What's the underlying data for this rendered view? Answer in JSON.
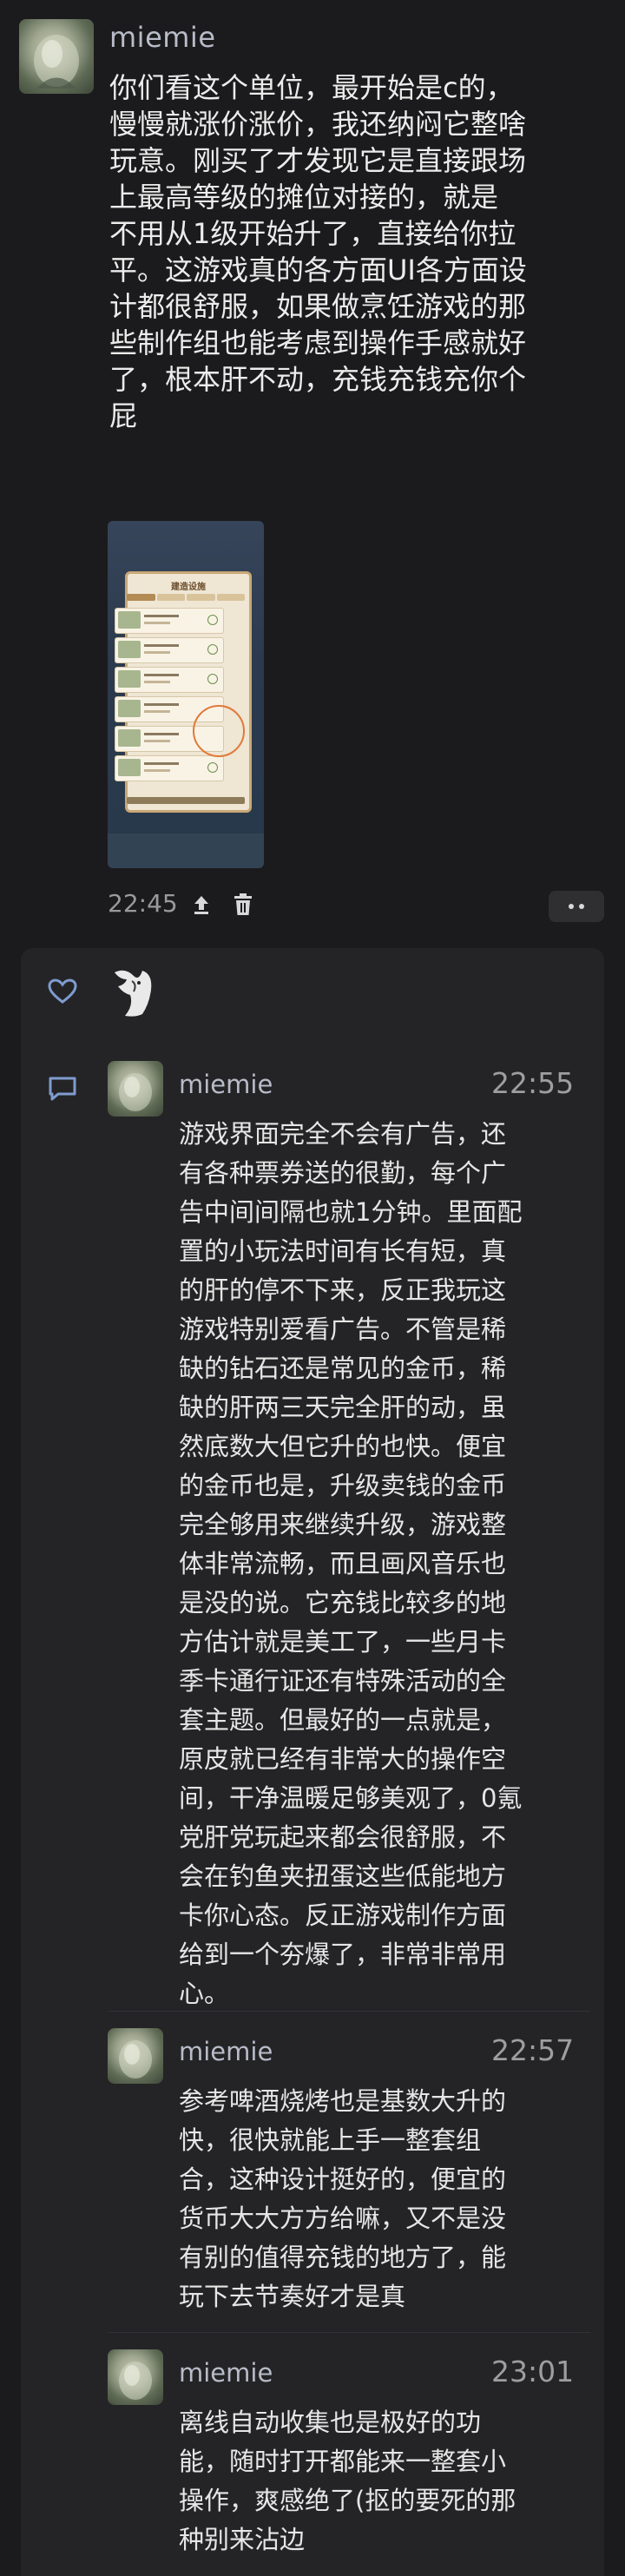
{
  "post": {
    "username": "miemie",
    "text": "你们看这个单位，最开始是c的，\n慢慢就涨价涨价，我还纳闷它整啥\n玩意。刚买了才发现它是直接跟场\n上最高等级的摊位对接的，就是\n不用从1级开始升了，直接给你拉\n平。这游戏真的各方面UI各方面设\n计都很舒服，如果做烹饪游戏的那\n些制作组也能考虑到操作手感就好\n了，根本肝不动，充钱充钱充你个\n屁",
    "image_caption": "建造设施",
    "time": "22:45",
    "share_icon": "share-up-icon",
    "delete_icon": "trash-icon",
    "more_icon": "more-dots-icon"
  },
  "reactions": {
    "like_icon": "heart-outline-icon",
    "comment_icon": "comment-bubble-icon"
  },
  "replies": [
    {
      "username": "miemie",
      "time": "22:55",
      "text": "游戏界面完全不会有广告，还\n有各种票券送的很勤，每个广\n告中间间隔也就1分钟。里面配\n置的小玩法时间有长有短，真\n的肝的停不下来，反正我玩这\n游戏特别爱看广告。不管是稀\n缺的钻石还是常见的金币，稀\n缺的肝两三天完全肝的动，虽\n然底数大但它升的也快。便宜\n的金币也是，升级卖钱的金币\n完全够用来继续升级，游戏整\n体非常流畅，而且画风音乐也\n是没的说。它充钱比较多的地\n方估计就是美工了，一些月卡\n季卡通行证还有特殊活动的全\n套主题。但最好的一点就是，\n原皮就已经有非常大的操作空\n间，干净温暖足够美观了，0氪\n党肝党玩起来都会很舒服，不\n会在钓鱼夹扭蛋这些低能地方\n卡你心态。反正游戏制作方面\n给到一个夯爆了，非常非常用\n心。"
    },
    {
      "username": "miemie",
      "time": "22:57",
      "text": "参考啤酒烧烤也是基数大升的\n快，很快就能上手一整套组\n合，这种设计挺好的，便宜的\n货币大大方方给嘛，又不是没\n有别的值得充钱的地方了，能\n玩下去节奏好才是真"
    },
    {
      "username": "miemie",
      "time": "23:01",
      "text": "离线自动收集也是极好的功\n能，随时打开都能来一整套小\n操作，爽感绝了(抠的要死的那\n种别来沾边"
    }
  ],
  "colors": {
    "background": "#1b1b1d",
    "card": "#242426",
    "accent_icon": "#7f9ccf",
    "username": "#b8bcc8"
  }
}
